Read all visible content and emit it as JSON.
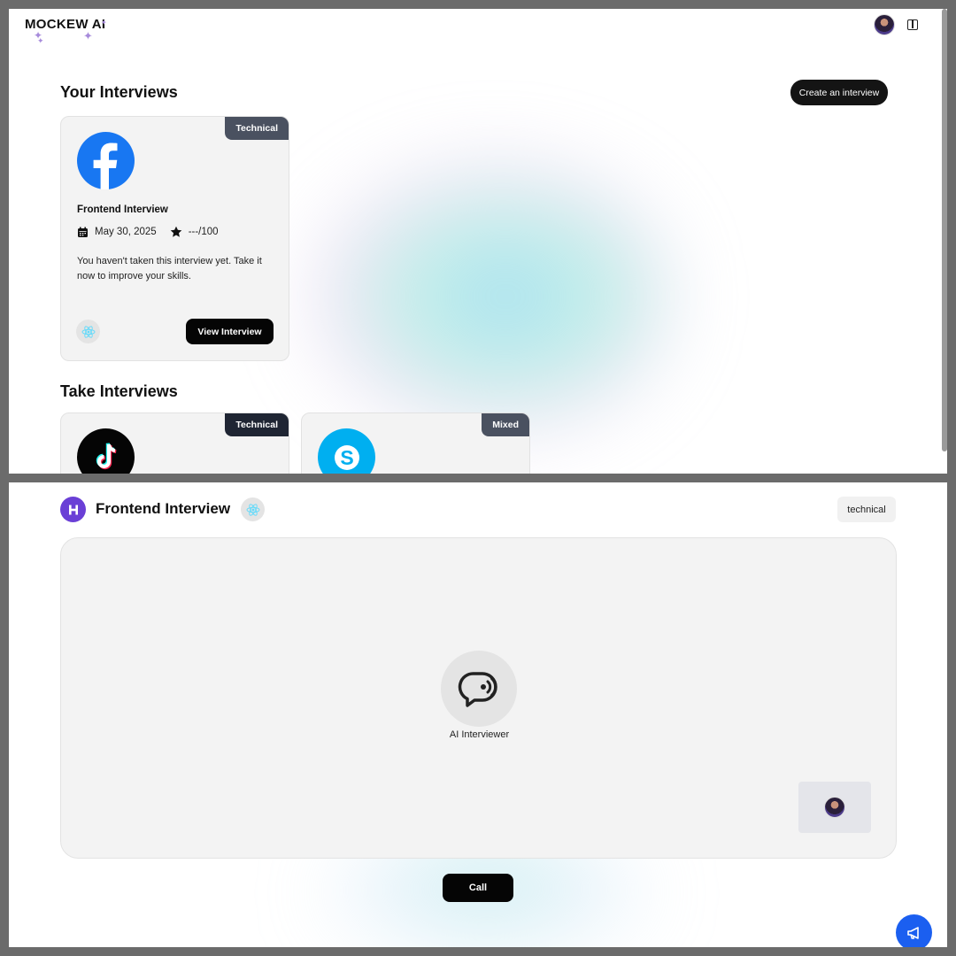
{
  "header": {
    "logo_text": "MOCKEW AI",
    "avatar_icon": "user-avatar",
    "toggle_icon": "sidebar-toggle-icon"
  },
  "your_interviews": {
    "title": "Your Interviews",
    "create_button": "Create an interview",
    "cards": [
      {
        "tag": "Technical",
        "company_icon": "facebook-logo",
        "title": "Frontend Interview",
        "date": "May 30, 2025",
        "score": "---/100",
        "description": "You haven't taken this interview yet. Take it now to improve your skills.",
        "tech_icon": "react-icon",
        "button": "View Interview"
      }
    ]
  },
  "take_interviews": {
    "title": "Take Interviews",
    "cards": [
      {
        "tag": "Technical",
        "company_icon": "tiktok-logo"
      },
      {
        "tag": "Mixed",
        "company_icon": "skype-logo"
      }
    ]
  },
  "interview_session": {
    "brand_icon": "hirrd-logo",
    "title": "Frontend Interview",
    "tech_icon": "react-icon",
    "type": "technical",
    "ai_label": "AI Interviewer",
    "call_button": "Call",
    "fab_icon": "megaphone-icon"
  },
  "colors": {
    "primary_dark": "#050505",
    "tag_gray": "#4a5160",
    "brand_purple": "#6a3fd6",
    "fab_blue": "#1b5ff0",
    "facebook_blue": "#1877f2",
    "skype_blue": "#00aff0"
  }
}
